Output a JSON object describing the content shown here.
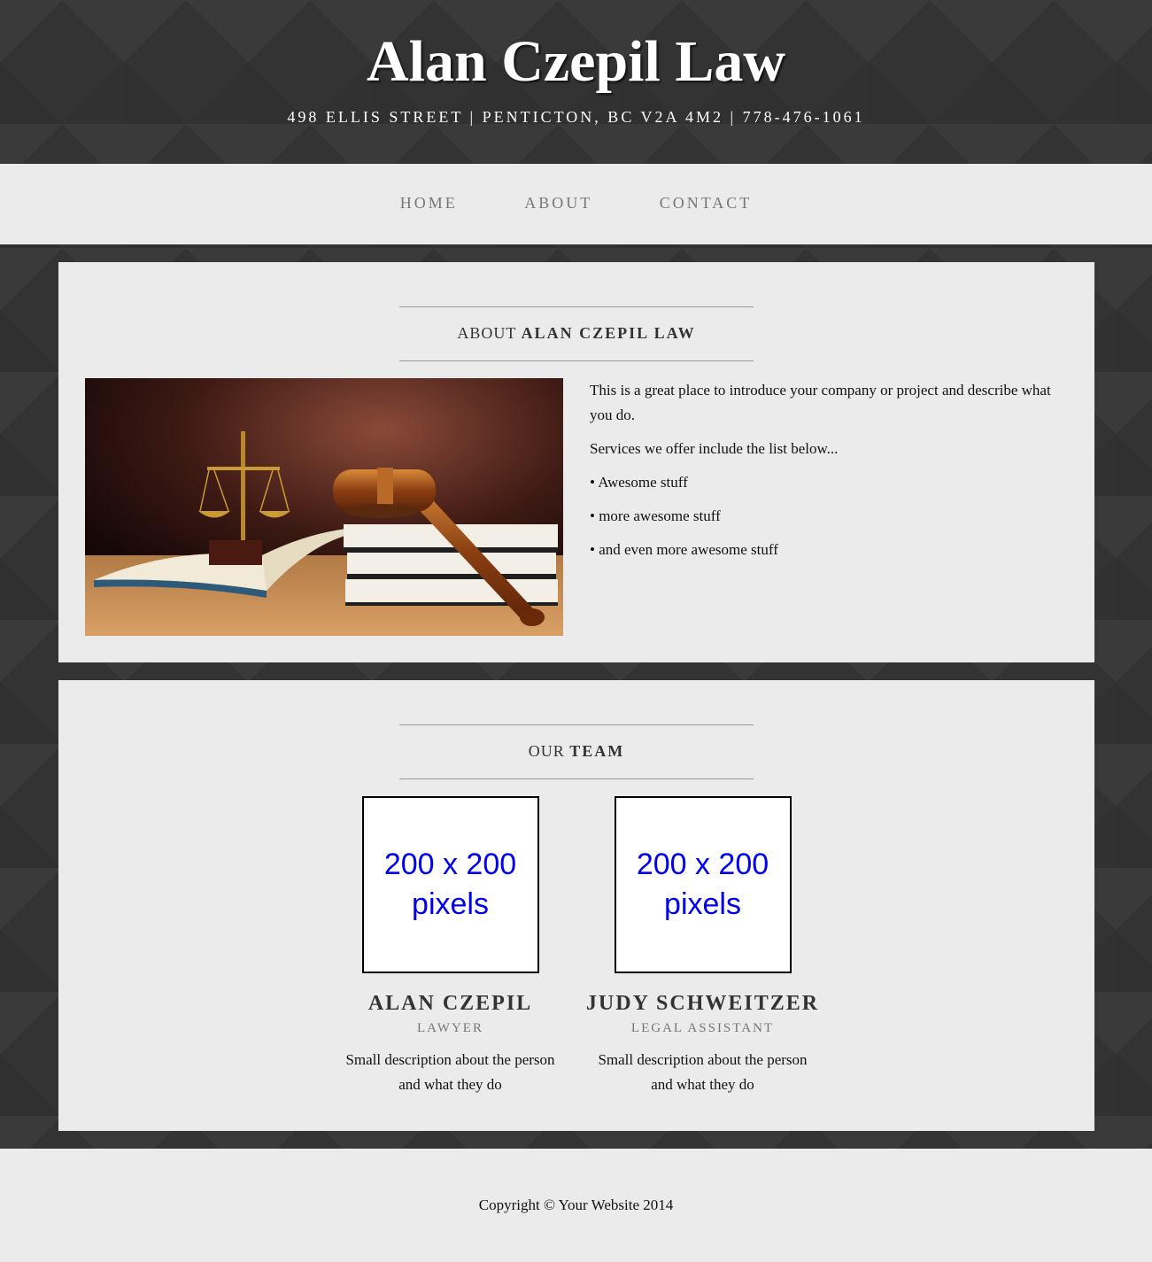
{
  "header": {
    "brand": "Alan Czepil Law",
    "address": "498 Ellis Street | Penticton, BC V2A 4M2 | 778-476-1061"
  },
  "nav": {
    "items": [
      {
        "label": "Home"
      },
      {
        "label": "About"
      },
      {
        "label": "Contact"
      }
    ]
  },
  "about": {
    "heading_prefix": "About",
    "heading_strong": "Alan Czepil Law",
    "image_icon": "scales-of-justice-and-gavel-photo",
    "paragraphs": [
      "This is a great place to introduce your company or project and describe what you do.",
      "Services we offer include the list below...",
      "• Awesome stuff",
      "• more awesome stuff",
      "• and even more awesome stuff"
    ]
  },
  "team": {
    "heading_prefix": "Our",
    "heading_strong": "Team",
    "members": [
      {
        "placeholder": "200 x 200 pixels",
        "name": "Alan Czepil",
        "role": "Lawyer",
        "description": "Small description about the person and what they do"
      },
      {
        "placeholder": "200 x 200 pixels",
        "name": "Judy Schweitzer",
        "role": "Legal Assistant",
        "description": "Small description about the person and what they do"
      }
    ]
  },
  "footer": {
    "copyright": "Copyright © Your Website 2014"
  },
  "colors": {
    "background": "#333333",
    "panel": "#ebebeb",
    "nav_text": "#777777",
    "placeholder_text": "#0000ee"
  }
}
